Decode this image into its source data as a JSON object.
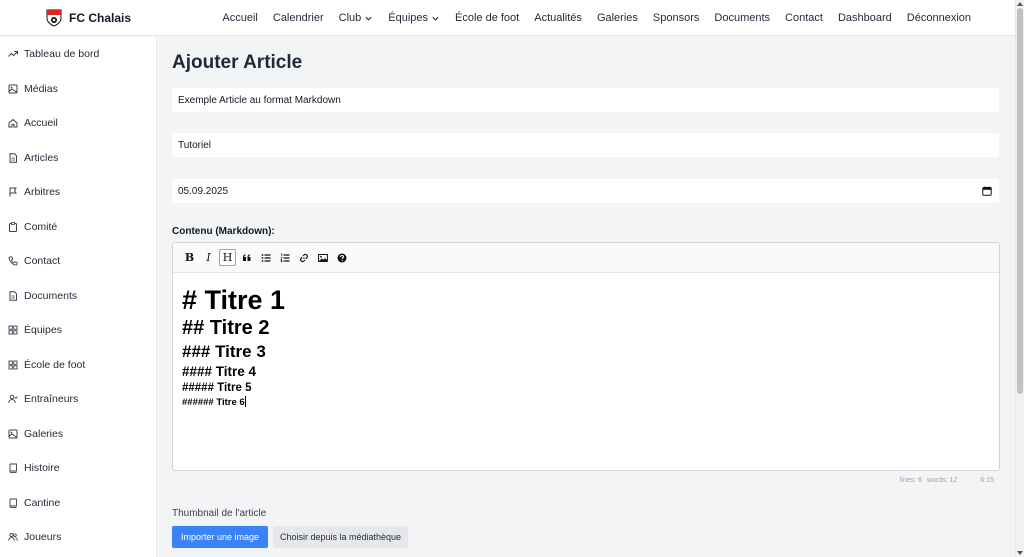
{
  "brand": {
    "name": "FC Chalais"
  },
  "nav": [
    {
      "label": "Accueil"
    },
    {
      "label": "Calendrier"
    },
    {
      "label": "Club",
      "dropdown": true
    },
    {
      "label": "Équipes",
      "dropdown": true
    },
    {
      "label": "École de foot"
    },
    {
      "label": "Actualités"
    },
    {
      "label": "Galeries"
    },
    {
      "label": "Sponsors"
    },
    {
      "label": "Documents"
    },
    {
      "label": "Contact"
    },
    {
      "label": "Dashboard"
    },
    {
      "label": "Déconnexion"
    }
  ],
  "sidebar": {
    "items": [
      {
        "label": "Tableau de bord",
        "icon": "trending-up-icon"
      },
      {
        "label": "Médias",
        "icon": "image-icon"
      },
      {
        "label": "Accueil",
        "icon": "home-icon"
      },
      {
        "label": "Articles",
        "icon": "document-icon"
      },
      {
        "label": "Arbitres",
        "icon": "flag-icon"
      },
      {
        "label": "Comité",
        "icon": "clipboard-icon"
      },
      {
        "label": "Contact",
        "icon": "phone-icon"
      },
      {
        "label": "Documents",
        "icon": "document-icon"
      },
      {
        "label": "Équipes",
        "icon": "grid-icon"
      },
      {
        "label": "École de foot",
        "icon": "grid-icon"
      },
      {
        "label": "Entraîneurs",
        "icon": "user-check-icon"
      },
      {
        "label": "Galeries",
        "icon": "image-icon"
      },
      {
        "label": "Histoire",
        "icon": "book-icon"
      },
      {
        "label": "Cantine",
        "icon": "book-icon"
      },
      {
        "label": "Joueurs",
        "icon": "users-icon"
      }
    ]
  },
  "main": {
    "title": "Ajouter Article",
    "title_field": "Exemple Article au format Markdown",
    "category_field": "Tutoriel",
    "date_field": "05.09.2025",
    "content_label": "Contenu (Markdown):",
    "toolbar": [
      "bold",
      "italic",
      "heading",
      "quote",
      "unordered-list",
      "ordered-list",
      "link",
      "image",
      "help"
    ],
    "toolbar_labels": {
      "bold": "B",
      "italic": "I",
      "heading": "H"
    },
    "content_lines": {
      "h1": "# Titre 1",
      "h2": "## Titre 2",
      "h3": "### Titre 3",
      "h4": "#### Titre 4",
      "h5": "##### Titre 5",
      "h6": "###### Titre 6"
    },
    "status": {
      "lines": "lines: 6",
      "words": "words: 12",
      "cursor": "6:15"
    },
    "thumbnail_label": "Thumbnail de l'article",
    "upload_button": "Importer une image",
    "library_button": "Choisir depuis la médiathèque"
  },
  "colors": {
    "primary": "#3b82f6",
    "background": "#f3f4f6",
    "sidebar": "#ffffff"
  }
}
